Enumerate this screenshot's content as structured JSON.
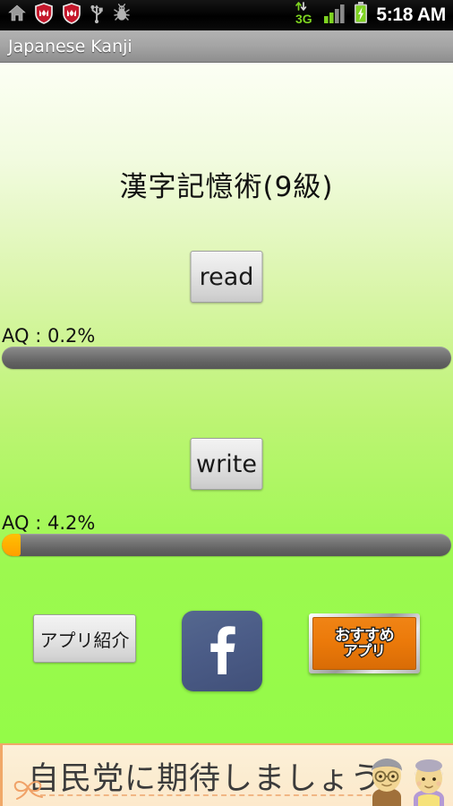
{
  "status_bar": {
    "icons": [
      "home-icon",
      "mcafee-shield-icon",
      "mcafee-shield-icon",
      "usb-icon",
      "android-debug-bug-icon"
    ],
    "network_label": "3G",
    "signal_icon": "signal-bars-icon",
    "battery_icon": "battery-charging-icon",
    "clock": "5:18 AM"
  },
  "title_bar": {
    "app_title": "Japanese Kanji"
  },
  "main": {
    "kanji_title": "漢字記憶術(9級)",
    "read": {
      "button_label": "read",
      "aq_label": "AQ : 0.2%",
      "progress_percent": 0.2
    },
    "write": {
      "button_label": "write",
      "aq_label": "AQ : 4.2%",
      "progress_percent": 4.2
    }
  },
  "bottom_row": {
    "app_intro_label": "アプリ紹介",
    "facebook_icon": "facebook-f-icon",
    "recommend": {
      "line1": "おすすめ",
      "line2": "アプリ"
    }
  },
  "ad_banner": {
    "text": "自民党に期待しましょう",
    "ribbon_icon": "ribbon-bow-icon",
    "person_man_icon": "elderly-man-icon",
    "person_woman_icon": "elderly-woman-icon"
  },
  "colors": {
    "background_top": "#fcfff4",
    "background_bottom": "#94fb48",
    "progress_track": "#6e6e6e",
    "progress_fill": "#ffb300",
    "facebook_blue": "#4b5c87",
    "recommend_orange": "#ec7a0a",
    "ad_background": "#fbecd0",
    "title_bar": "#a4a4a4"
  }
}
